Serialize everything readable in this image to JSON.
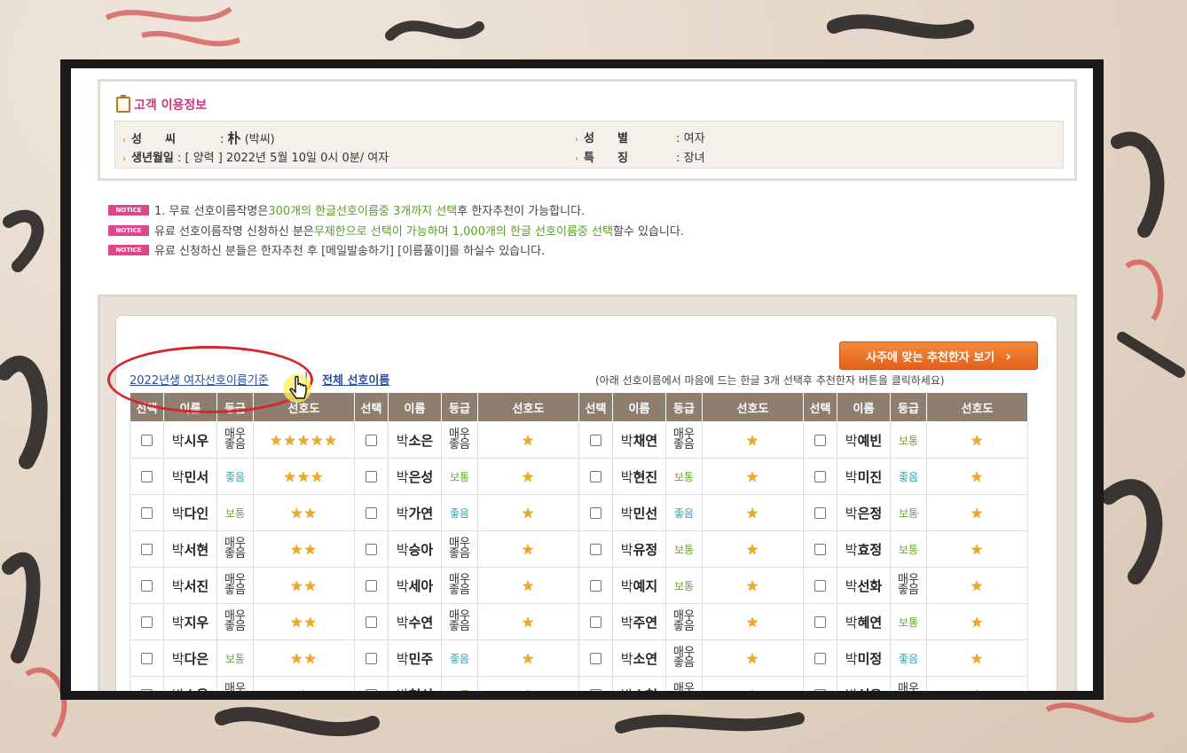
{
  "info": {
    "title": "고객 이용정보",
    "surname_label": "성　　씨",
    "surname_value": "朴",
    "surname_value_sub": "(박씨)",
    "gender_label": "성　　별",
    "gender_value": ": 여자",
    "birth_label": "생년월일",
    "birth_value": ": [ 양력 ] 2022년 5월 10일 0시 0분/ 여자",
    "feature_label": "특　　징",
    "feature_value": ": 장녀",
    "colon": ":"
  },
  "notices": {
    "badge": "NOTICE",
    "n1_a": "1. 무료 선호이름작명은 ",
    "n1_b": "300개의 한글선호이름중 3개까지 선택",
    "n1_c": "후 한자추천이 가능합니다.",
    "n2_a": "유료 선호이름작명 신청하신 분은",
    "n2_b": "무제한으로 선택이 가능하며 1,000개의 한글 선호이름중 선택",
    "n2_c": "할수 있습니다.",
    "n3": "유료 신청하신 분들은 한자추천 후 [메일발송하기] [이름풀이]를 하실수 있습니다."
  },
  "main": {
    "recommend_button": "사주에 맞는 추천한자 보기",
    "link_2022": "2022년생 여자선호이름기준",
    "separator": "|",
    "link_all": "전체 선호이름",
    "hint": "(아래 선호이름에서 마음에 드는 한글 3개 선택후 추천한자 버튼을 클릭하세요)"
  },
  "table": {
    "headers": [
      "선택",
      "이름",
      "등급",
      "선호도"
    ],
    "rows": [
      [
        {
          "s": "박",
          "g": "시우",
          "grade": "best",
          "stars": "★★★★★"
        },
        {
          "s": "박",
          "g": "소은",
          "grade": "best",
          "stars": "★"
        },
        {
          "s": "박",
          "g": "채연",
          "grade": "best",
          "stars": "★"
        },
        {
          "s": "박",
          "g": "예빈",
          "grade": "mid",
          "stars": "★"
        }
      ],
      [
        {
          "s": "박",
          "g": "민서",
          "grade": "good",
          "stars": "★★★"
        },
        {
          "s": "박",
          "g": "은성",
          "grade": "mid",
          "stars": "★"
        },
        {
          "s": "박",
          "g": "현진",
          "grade": "mid",
          "stars": "★"
        },
        {
          "s": "박",
          "g": "미진",
          "grade": "good",
          "stars": "★"
        }
      ],
      [
        {
          "s": "박",
          "g": "다인",
          "grade": "mid",
          "stars": "★★"
        },
        {
          "s": "박",
          "g": "가연",
          "grade": "good",
          "stars": "★"
        },
        {
          "s": "박",
          "g": "민선",
          "grade": "good",
          "stars": "★"
        },
        {
          "s": "박",
          "g": "은정",
          "grade": "mid",
          "stars": "★"
        }
      ],
      [
        {
          "s": "박",
          "g": "서현",
          "grade": "best",
          "stars": "★★"
        },
        {
          "s": "박",
          "g": "승아",
          "grade": "best",
          "stars": "★"
        },
        {
          "s": "박",
          "g": "유정",
          "grade": "mid",
          "stars": "★"
        },
        {
          "s": "박",
          "g": "효정",
          "grade": "mid",
          "stars": "★"
        }
      ],
      [
        {
          "s": "박",
          "g": "서진",
          "grade": "best",
          "stars": "★★"
        },
        {
          "s": "박",
          "g": "세아",
          "grade": "best",
          "stars": "★"
        },
        {
          "s": "박",
          "g": "예지",
          "grade": "mid",
          "stars": "★"
        },
        {
          "s": "박",
          "g": "선화",
          "grade": "best",
          "stars": "★"
        }
      ],
      [
        {
          "s": "박",
          "g": "지우",
          "grade": "best",
          "stars": "★★"
        },
        {
          "s": "박",
          "g": "수연",
          "grade": "best",
          "stars": "★"
        },
        {
          "s": "박",
          "g": "주연",
          "grade": "best",
          "stars": "★"
        },
        {
          "s": "박",
          "g": "혜연",
          "grade": "mid",
          "stars": "★"
        }
      ],
      [
        {
          "s": "박",
          "g": "다은",
          "grade": "mid",
          "stars": "★★"
        },
        {
          "s": "박",
          "g": "민주",
          "grade": "good",
          "stars": "★"
        },
        {
          "s": "박",
          "g": "소연",
          "grade": "best",
          "stars": "★"
        },
        {
          "s": "박",
          "g": "미정",
          "grade": "good",
          "stars": "★"
        }
      ],
      [
        {
          "s": "박",
          "g": "소율",
          "grade": "best",
          "stars": "★"
        },
        {
          "s": "박",
          "g": "현서",
          "grade": "mid",
          "stars": "★"
        },
        {
          "s": "박",
          "g": "소현",
          "grade": "best",
          "stars": "★"
        },
        {
          "s": "박",
          "g": "성은",
          "grade": "best",
          "stars": "★"
        }
      ]
    ],
    "grade_labels": {
      "best": "매우좋음",
      "good": "좋음",
      "mid": "보통"
    }
  },
  "colors": {
    "accent_pink": "#d0357c",
    "header_brown": "#8e7e70",
    "button_orange": "#e4601a",
    "link_blue": "#2b4c99"
  }
}
